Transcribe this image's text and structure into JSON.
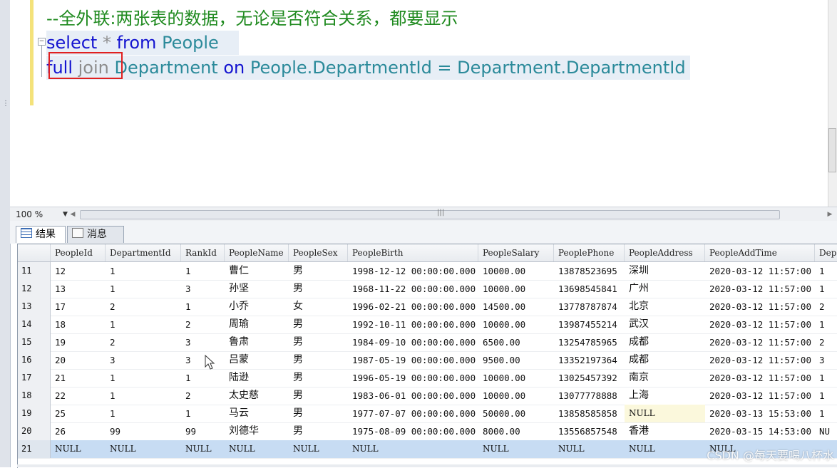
{
  "editor": {
    "comment": "--全外联:两张表的数据，无论是否符合关系，都要显示",
    "line2": {
      "kw_select": "select",
      "star": " * ",
      "kw_from": "from",
      "table": " People"
    },
    "line3": {
      "kw_full": "full",
      "kw_join": " join",
      "rest_table": " Department ",
      "kw_on": "on",
      "cond": " People.DepartmentId = Department.DepartmentId"
    }
  },
  "zoom": {
    "value": "100 %"
  },
  "tabs": {
    "results": "结果",
    "messages": "消息"
  },
  "grid": {
    "columns": [
      "PeopleId",
      "DepartmentId",
      "RankId",
      "PeopleName",
      "PeopleSex",
      "PeopleBirth",
      "PeopleSalary",
      "PeoplePhone",
      "PeopleAddress",
      "PeopleAddTime",
      "Dep"
    ],
    "rows": [
      [
        "11",
        "12",
        "1",
        "1",
        "曹仁",
        "男",
        "1998-12-12 00:00:00.000",
        "10000.00",
        "13878523695",
        "深圳",
        "2020-03-12 11:57:00",
        "1"
      ],
      [
        "12",
        "13",
        "1",
        "3",
        "孙坚",
        "男",
        "1968-11-22 00:00:00.000",
        "10000.00",
        "13698545841",
        "广州",
        "2020-03-12 11:57:00",
        "1"
      ],
      [
        "13",
        "17",
        "2",
        "1",
        "小乔",
        "女",
        "1996-02-21 00:00:00.000",
        "14500.00",
        "13778787874",
        "北京",
        "2020-03-12 11:57:00",
        "2"
      ],
      [
        "14",
        "18",
        "1",
        "2",
        "周瑜",
        "男",
        "1992-10-11 00:00:00.000",
        "10000.00",
        "13987455214",
        "武汉",
        "2020-03-12 11:57:00",
        "1"
      ],
      [
        "15",
        "19",
        "2",
        "3",
        "鲁肃",
        "男",
        "1984-09-10 00:00:00.000",
        "6500.00",
        "13254785965",
        "成都",
        "2020-03-12 11:57:00",
        "2"
      ],
      [
        "16",
        "20",
        "3",
        "3",
        "吕蒙",
        "男",
        "1987-05-19 00:00:00.000",
        "9500.00",
        "13352197364",
        "成都",
        "2020-03-12 11:57:00",
        "3"
      ],
      [
        "17",
        "21",
        "1",
        "1",
        "陆逊",
        "男",
        "1996-05-19 00:00:00.000",
        "10000.00",
        "13025457392",
        "南京",
        "2020-03-12 11:57:00",
        "1"
      ],
      [
        "18",
        "22",
        "1",
        "2",
        "太史慈",
        "男",
        "1983-06-01 00:00:00.000",
        "10000.00",
        "13077778888",
        "上海",
        "2020-03-12 11:57:00",
        "1"
      ],
      [
        "19",
        "25",
        "1",
        "1",
        "马云",
        "男",
        "1977-07-07 00:00:00.000",
        "50000.00",
        "13858585858",
        "NULL",
        "2020-03-13 15:53:00",
        "1"
      ],
      [
        "20",
        "26",
        "99",
        "99",
        "刘德华",
        "男",
        "1975-08-09 00:00:00.000",
        "8000.00",
        "13556857548",
        "香港",
        "2020-03-15 14:53:00",
        "NU"
      ],
      [
        "21",
        "NULL",
        "NULL",
        "NULL",
        "NULL",
        "NULL",
        "NULL",
        "NULL",
        "NULL",
        "NULL",
        "NULL",
        ""
      ]
    ]
  },
  "watermark": "CSDN @每天要喝八杯水"
}
